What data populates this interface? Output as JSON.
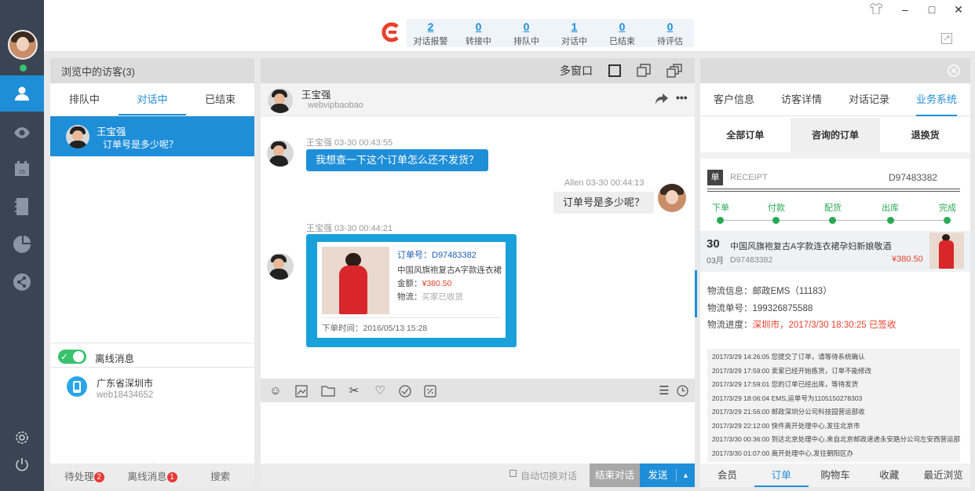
{
  "stats": [
    {
      "num": "2",
      "label": "对话报警"
    },
    {
      "num": "0",
      "label": "转接中"
    },
    {
      "num": "0",
      "label": "排队中"
    },
    {
      "num": "1",
      "label": "对话中"
    },
    {
      "num": "0",
      "label": "已结束"
    },
    {
      "num": "0",
      "label": "待评估"
    }
  ],
  "left": {
    "header": "浏览中的访客(3)",
    "tabs": [
      "排队中",
      "对话中",
      "已结束"
    ],
    "active_visitor": {
      "name": "王宝强",
      "message": "订单号是多少呢？"
    },
    "offline_toggle_label": "离线消息",
    "offline_visitor": {
      "location": "广东省深圳市",
      "id": "web18434652"
    },
    "bottom": {
      "pending": "待处理",
      "pending_count": "2",
      "offline": "离线消息",
      "offline_count": "1",
      "search": "搜索"
    }
  },
  "chat": {
    "header_label": "多窗口",
    "contact_name": "王宝强",
    "contact_id": "webvipbaobao",
    "messages": [
      {
        "meta": "王宝强 03-30 00:43:55",
        "text": "我想查一下这个订单怎么还不发货？"
      },
      {
        "meta": "Allen 03-30 00:44:13",
        "text": "订单号是多少呢？"
      },
      {
        "meta": "王宝强 03-30 00:44:21"
      }
    ],
    "card": {
      "order_label": "订单号：D97483382",
      "title": "中国风旗袍复古A字款连衣裙",
      "amount_label": "金额：",
      "amount": "¥380.50",
      "logistics_label": "物流：",
      "logistics": "买家已收货",
      "time": "下单时间：2016/05/13 15:28"
    },
    "auto_switch": "自动切换对话",
    "end_button": "结束对话",
    "send_button": "发送"
  },
  "right": {
    "tabs": [
      "客户信息",
      "访客详情",
      "对话记录",
      "业务系统"
    ],
    "subtabs": [
      "全部订单",
      "咨询的订单",
      "退换货"
    ],
    "receipt_badge": "单",
    "receipt_label": "RECEIPT",
    "receipt_no": "D97483382",
    "steps": [
      "下单",
      "付款",
      "配货",
      "出库",
      "完成"
    ],
    "order": {
      "day": "30",
      "month": "03月",
      "title": "中国风旗袍复古A字款连衣裙孕妇新娘敬酒",
      "code": "D97483382",
      "price": "¥380.50"
    },
    "logistics_info": "物流信息：邮政EMS（11183）",
    "logistics_no": "物流单号：199326875588",
    "logistics_progress_label": "物流进度：",
    "logistics_progress": "深圳市，2017/3/30 18:30:25 已签收",
    "log": [
      "2017/3/29 14:26:05   您提交了订单，请等待系统确认",
      "2017/3/29 17:59:00   卖家已经开始拣货，订单不能修改",
      "2017/3/29 17:59:01   您的订单已经出库，等待发货",
      "2017/3/29 18:06:04   EMS,运单号为1105150278303",
      "2017/3/29 21:56:00   邮政深圳分公司科技园营运部收",
      "2017/3/29 22:12:00   快件离开处理中心,发往北京市",
      "2017/3/30 00:36:00   到达北京处理中心,来自北京邮政速递永安路分公司左安西营运部",
      "2017/3/30 01:07:00   离开处理中心,发往朝阳区办"
    ],
    "bottom_tabs": [
      "会员",
      "订单",
      "购物车",
      "收藏",
      "最近浏览"
    ]
  },
  "colors": {
    "accent": "#1f8ed8",
    "price": "#e8412c",
    "rail": "#3a4452",
    "badge": "#e53935",
    "step": "#2aa955"
  }
}
